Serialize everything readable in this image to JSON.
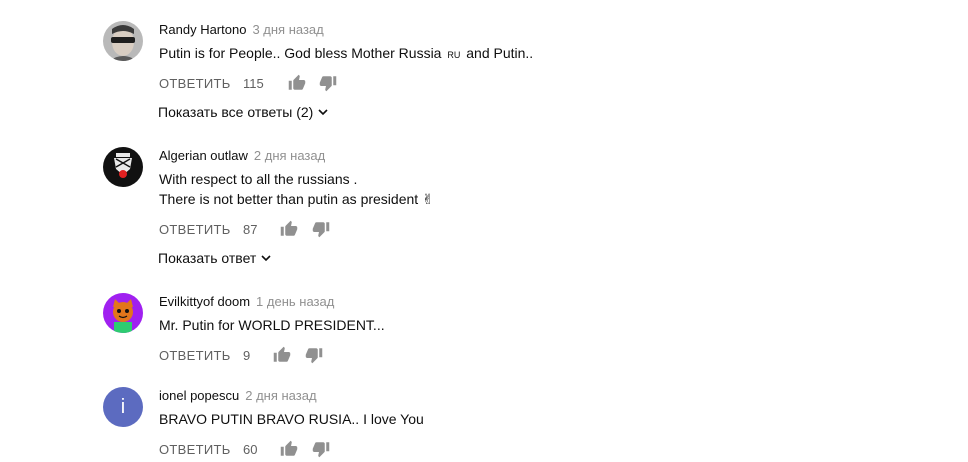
{
  "comments": [
    {
      "author": "Randy Hartono",
      "time": "3 дня назад",
      "lines": [
        "Putin is for People.. God bless Mother Russia ",
        " and Putin.."
      ],
      "flag": "RU",
      "reply_label": "ОТВЕТИТЬ",
      "likes": "115",
      "replies_toggle": "Показать все ответы (2)"
    },
    {
      "author": "Algerian outlaw",
      "time": "2 дня назад",
      "lines": [
        "With respect to all the russians .",
        "There is not  better than putin as president ✌"
      ],
      "reply_label": "ОТВЕТИТЬ",
      "likes": "87",
      "replies_toggle": "Показать ответ"
    },
    {
      "author": "Evilkittyof doom",
      "time": "1 день назад",
      "lines": [
        "Mr. Putin for WORLD PRESIDENT..."
      ],
      "reply_label": "ОТВЕТИТЬ",
      "likes": "9"
    },
    {
      "author": "ionel popescu",
      "avatar_letter": "i",
      "avatar_color": "#5c6bc0",
      "time": "2 дня назад",
      "lines": [
        "BRAVO PUTIN BRAVO RUSIA.. I love You"
      ],
      "reply_label": "ОТВЕТИТЬ",
      "likes": "60"
    }
  ],
  "colors": {
    "text": "#0f0f0f",
    "secondary": "#606060",
    "timestamp": "#909090",
    "icon": "#909090"
  },
  "icons": {
    "like": "thumb-up-icon",
    "dislike": "thumb-down-icon",
    "expand": "chevron-down-icon"
  }
}
